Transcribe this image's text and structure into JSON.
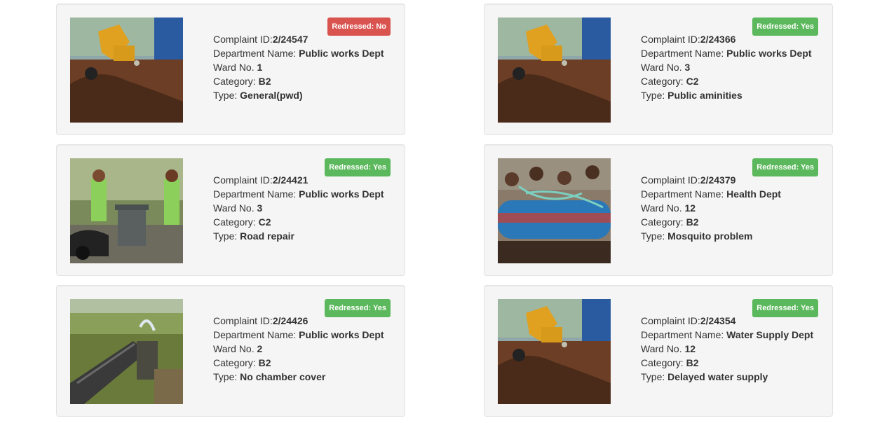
{
  "labels": {
    "complaint_id": "Complaint ID:",
    "department": "Department Name: ",
    "ward": "Ward No. ",
    "category": "Category: ",
    "type": "Type: "
  },
  "complaints": [
    {
      "status_text": "Redressed: No",
      "status": "no",
      "id": "2/24547",
      "department": "Public works Dept",
      "ward": "1",
      "category": "B2",
      "type": "General(pwd)",
      "image": "excavator-photo"
    },
    {
      "status_text": "Redressed: Yes",
      "status": "yes",
      "id": "2/24366",
      "department": "Public works Dept",
      "ward": "3",
      "category": "C2",
      "type": "Public aminities",
      "image": "excavator-photo"
    },
    {
      "status_text": "Redressed: Yes",
      "status": "yes",
      "id": "2/24421",
      "department": "Public works Dept",
      "ward": "3",
      "category": "C2",
      "type": "Road repair",
      "image": "garbage-bin-photo"
    },
    {
      "status_text": "Redressed: Yes",
      "status": "yes",
      "id": "2/24379",
      "department": "Health Dept",
      "ward": "12",
      "category": "B2",
      "type": "Mosquito problem",
      "image": "water-tanker-photo"
    },
    {
      "status_text": "Redressed: Yes",
      "status": "yes",
      "id": "2/24426",
      "department": "Public works Dept",
      "ward": "2",
      "category": "B2",
      "type": "No chamber cover",
      "image": "leaking-pipe-photo"
    },
    {
      "status_text": "Redressed: Yes",
      "status": "yes",
      "id": "2/24354",
      "department": "Water Supply Dept",
      "ward": "12",
      "category": "B2",
      "type": "Delayed water supply",
      "image": "excavator-photo"
    }
  ],
  "colors": {
    "yes": "#5cb85c",
    "no": "#d9534f",
    "card_bg": "#f5f5f5"
  }
}
